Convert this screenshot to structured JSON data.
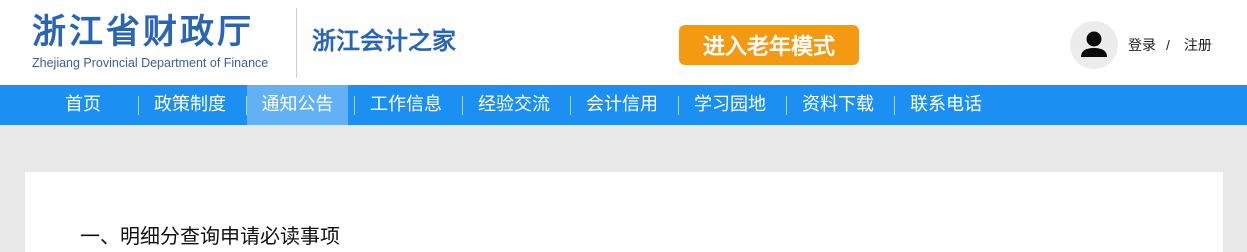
{
  "header": {
    "logo_cn": "浙江省财政厅",
    "logo_en": "Zhejiang Provincial Department of Finance",
    "site_name": "浙江会计之家",
    "elder_mode_label": "进入老年模式",
    "login_label": "登录",
    "auth_separator": "/",
    "register_label": "注册",
    "avatar_icon": "user-avatar-icon"
  },
  "nav": {
    "items": [
      {
        "label": "首页"
      },
      {
        "label": "政策制度"
      },
      {
        "label": "通知公告"
      },
      {
        "label": "工作信息"
      },
      {
        "label": "经验交流"
      },
      {
        "label": "会计信用"
      },
      {
        "label": "学习园地"
      },
      {
        "label": "资料下载"
      },
      {
        "label": "联系电话"
      }
    ],
    "active_index": 2
  },
  "content": {
    "section_title": "一、明细分查询申请必读事项"
  },
  "colors": {
    "brand_blue": "#2a64b4",
    "nav_bg": "#1c8ff2",
    "nav_active": "#63b1f5",
    "elder_button": "#f39a12",
    "page_bg": "#e8e8e8"
  }
}
